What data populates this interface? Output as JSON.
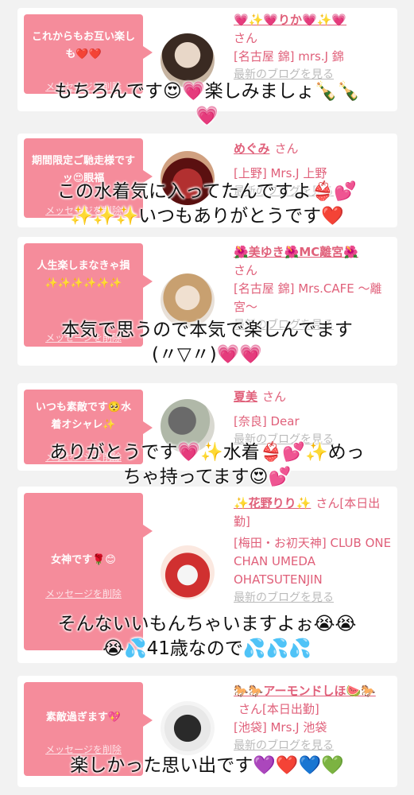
{
  "cards": [
    {
      "message": "これからもお互い楽しも❤️❤️",
      "delete_label": "メッセージを削除",
      "name": "💗✨💗りか💗✨💗",
      "san": "さん",
      "store": "[名古屋 錦] mrs.J 錦",
      "blog": "最新のブログを見る",
      "overlay": "もちろんです😍💗楽しみましょ🍾🍾\n💗"
    },
    {
      "message": "期間限定ご馳走様ですッ😍眼福",
      "delete_label": "メッセージを削除",
      "name": "めぐみ",
      "san": "さん",
      "store": "[上野] Mrs.J 上野",
      "blog": "最新のブログを見る",
      "overlay": "この水着気に入ってたんですよ👙💕\n✨✨✨いつもありがとうです❤️"
    },
    {
      "message": "人生楽しまなきゃ損 ✨✨✨✨✨✨",
      "delete_label": "メッセージを削除",
      "name": "🌺美ゆき🌺MC離宮🌺",
      "san": "さん",
      "store": "[名古屋 錦] Mrs.CAFE 〜離宮〜",
      "blog": "最新のブログを見る",
      "overlay": "本気で思うので本気で楽しんでます\n(〃▽〃)💗💗"
    },
    {
      "message": "いつも素敵です🥺水着オシャレ✨",
      "delete_label": "メッセージを削除",
      "name": "夏美",
      "san": "さん",
      "store": "[奈良] Dear",
      "blog": "最新のブログを見る",
      "overlay": "ありがとうです💗✨水着👙💕✨めっ\nちゃ持ってます😍💕"
    },
    {
      "message": "女神です🌹😊",
      "delete_label": "メッセージを削除",
      "name": "✨花野りり✨",
      "san": "さん[本日出勤]",
      "store": "[梅田・お初天神] CLUB ONE CHAN UMEDA OHATSUTENJIN",
      "blog": "最新のブログを見る",
      "overlay": "そんないいもんちゃいますよぉ😭😭\n😭💦41歳なので💦💦💦"
    },
    {
      "message": "素敵過ぎます💖",
      "delete_label": "メッセージを削除",
      "name": "🐎🐎アーモンドしほ🍉🐎",
      "san": "さん[本日出勤]",
      "store": "[池袋] Mrs.J 池袋",
      "blog": "最新のブログを見る",
      "overlay": "楽しかった思い出です💜❤️💙💚"
    }
  ],
  "colors": {
    "bubble": "#f58c9b",
    "name": "#e0607a",
    "background": "#f2f2f2"
  }
}
